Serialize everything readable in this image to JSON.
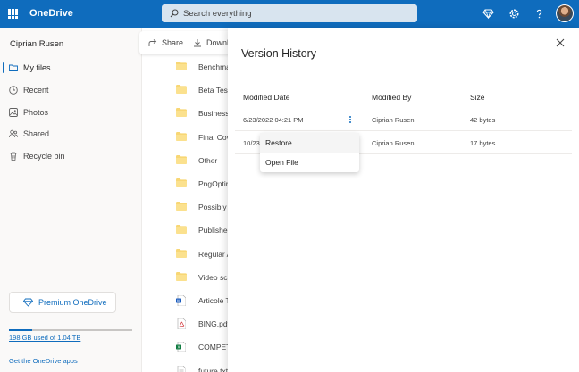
{
  "app": {
    "brand": "OneDrive"
  },
  "search": {
    "placeholder": "Search everything"
  },
  "sidebar": {
    "user_name": "Ciprian Rusen",
    "items": [
      {
        "label": "My files",
        "icon": "folder-icon",
        "active": true
      },
      {
        "label": "Recent",
        "icon": "clock-icon",
        "active": false
      },
      {
        "label": "Photos",
        "icon": "image-icon",
        "active": false
      },
      {
        "label": "Shared",
        "icon": "people-icon",
        "active": false
      },
      {
        "label": "Recycle bin",
        "icon": "trash-icon",
        "active": false
      }
    ],
    "premium_label": "Premium OneDrive",
    "storage_text": "198 GB used of 1.04 TB",
    "storage_fraction": 0.186,
    "get_apps": "Get the OneDrive apps"
  },
  "toolbar": {
    "share_label": "Share",
    "download_label": "Downl"
  },
  "files": [
    {
      "name": "Benchma",
      "type": "folder"
    },
    {
      "name": "Beta Test",
      "type": "folder"
    },
    {
      "name": "Business",
      "type": "folder"
    },
    {
      "name": "Final Cov",
      "type": "folder"
    },
    {
      "name": "Other",
      "type": "folder"
    },
    {
      "name": "PngOptin",
      "type": "folder"
    },
    {
      "name": "Possibly",
      "type": "folder"
    },
    {
      "name": "Publishe",
      "type": "folder"
    },
    {
      "name": "Regular A",
      "type": "folder"
    },
    {
      "name": "Video scr",
      "type": "folder"
    },
    {
      "name": "Articole T",
      "type": "word"
    },
    {
      "name": "BING.pdf",
      "type": "pdf"
    },
    {
      "name": "COMPETI",
      "type": "excel"
    },
    {
      "name": "future.txt",
      "type": "text"
    }
  ],
  "version_panel": {
    "title": "Version History",
    "columns": {
      "date": "Modified Date",
      "by": "Modified By",
      "size": "Size"
    },
    "rows": [
      {
        "date": "6/23/2022 04:21 PM",
        "by": "Ciprian Rusen",
        "size": "42 bytes"
      },
      {
        "date": "10/23",
        "by": "Ciprian Rusen",
        "size": "17 bytes"
      }
    ],
    "menu": [
      "Restore",
      "Open File"
    ]
  },
  "colors": {
    "accent": "#0f6cbd",
    "folder": "#f8d775"
  }
}
